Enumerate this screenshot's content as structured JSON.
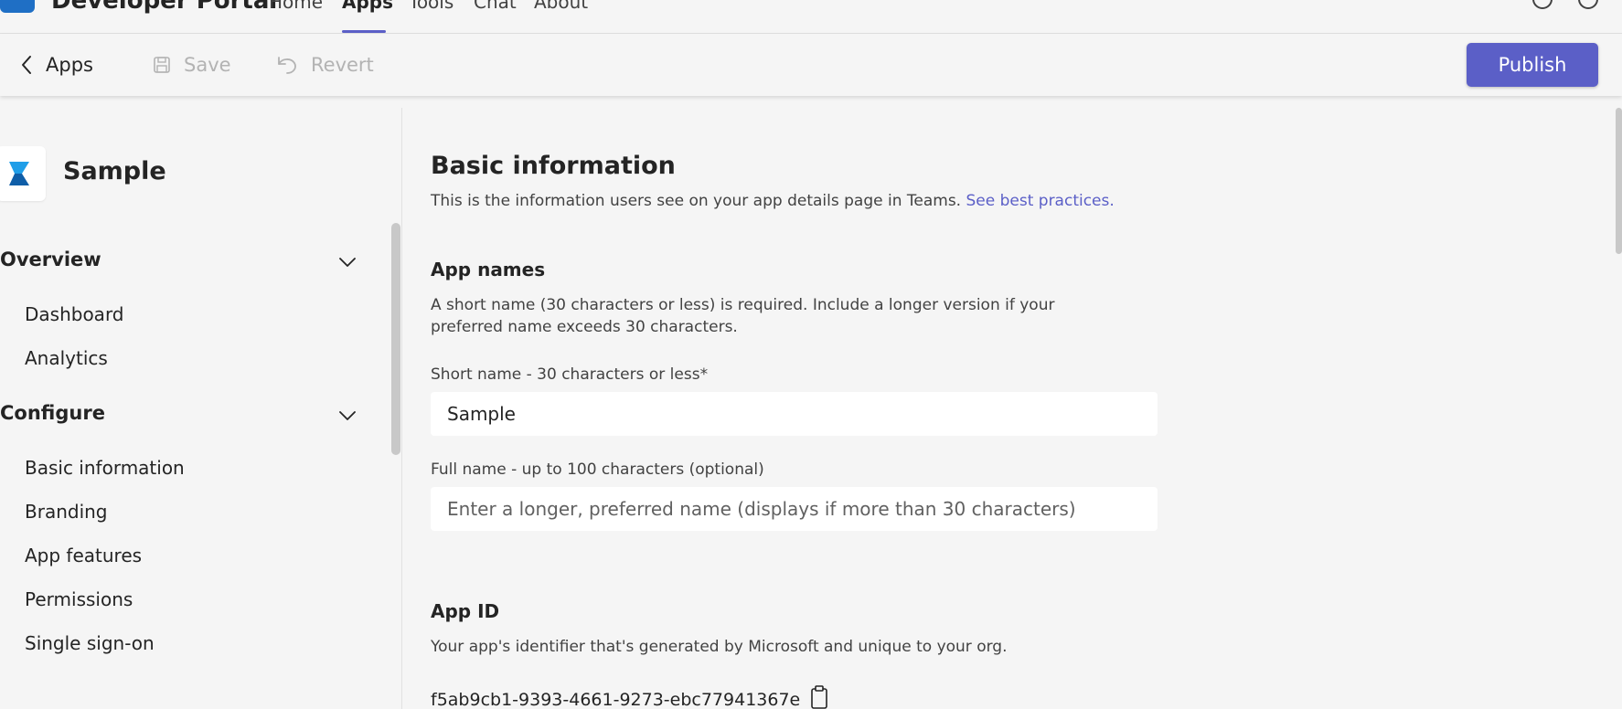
{
  "topnav": {
    "brand": "Developer Portal",
    "tabs": [
      {
        "label": "Home"
      },
      {
        "label": "Apps"
      },
      {
        "label": "Tools"
      },
      {
        "label": "Chat"
      },
      {
        "label": "About"
      }
    ]
  },
  "commandbar": {
    "back_label": "Apps",
    "save_label": "Save",
    "revert_label": "Revert",
    "publish_label": "Publish"
  },
  "sidebar": {
    "app_name": "Sample",
    "sections": [
      {
        "title": "Overview",
        "items": [
          "Dashboard",
          "Analytics"
        ]
      },
      {
        "title": "Configure",
        "items": [
          "Basic information",
          "Branding",
          "App features",
          "Permissions",
          "Single sign-on"
        ]
      }
    ]
  },
  "main": {
    "title": "Basic information",
    "description": "This is the information users see on your app details page in Teams.",
    "description_link": "See best practices.",
    "app_names": {
      "heading": "App names",
      "help": "A short name (30 characters or less) is required. Include a longer version if your preferred name exceeds 30 characters.",
      "short_name_label": "Short name - 30 characters or less*",
      "short_name_value": "Sample",
      "full_name_label": "Full name - up to 100 characters (optional)",
      "full_name_placeholder": "Enter a longer, preferred name (displays if more than 30 characters)"
    },
    "app_id": {
      "heading": "App ID",
      "help": "Your app's identifier that's generated by Microsoft and unique to your org.",
      "value": "f5ab9cb1-9393-4661-9273-ebc77941367e"
    }
  },
  "colors": {
    "accent": "#5b5fc7",
    "background": "#f5f5f5",
    "disabled_text": "#b3b3b3"
  }
}
